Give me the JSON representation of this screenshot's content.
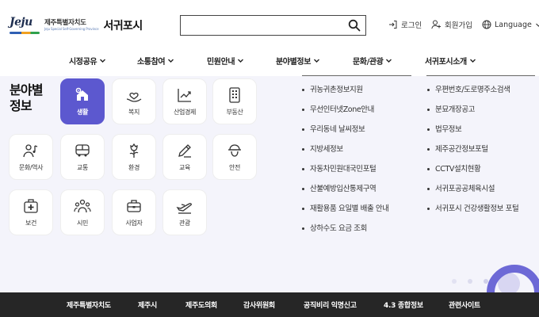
{
  "header": {
    "logo": {
      "mark_text": "Jeju",
      "province": "제주특별자치도",
      "province_en": "Jeju Special Self-Governing Province",
      "city": "서귀포시"
    },
    "search": {
      "value": "",
      "placeholder": ""
    },
    "login_label": "로그인",
    "join_label": "회원가입",
    "language_label": "Language"
  },
  "gnb": [
    {
      "label": "시정공유"
    },
    {
      "label": "소통참여"
    },
    {
      "label": "민원안내"
    },
    {
      "label": "분야별정보"
    },
    {
      "label": "문화/관광"
    },
    {
      "label": "서귀포시소개"
    }
  ],
  "section": {
    "title_line1": "분야별",
    "title_line2": "정보"
  },
  "categories": [
    {
      "label": "생활",
      "icon": "home-gear-icon",
      "active": true
    },
    {
      "label": "복지",
      "icon": "heart-hand-icon",
      "active": false
    },
    {
      "label": "산업경제",
      "icon": "trend-chart-icon",
      "active": false
    },
    {
      "label": "부동산",
      "icon": "building-icon",
      "active": false
    },
    {
      "label": "문화/역사",
      "icon": "person-music-icon",
      "active": false
    },
    {
      "label": "교통",
      "icon": "bus-icon",
      "active": false
    },
    {
      "label": "환경",
      "icon": "flower-icon",
      "active": false
    },
    {
      "label": "교육",
      "icon": "pencil-icon",
      "active": false
    },
    {
      "label": "안전",
      "icon": "helmet-icon",
      "active": false
    },
    {
      "label": "보건",
      "icon": "medical-kit-icon",
      "active": false
    },
    {
      "label": "시민",
      "icon": "people-icon",
      "active": false
    },
    {
      "label": "사업자",
      "icon": "briefcase-icon",
      "active": false
    },
    {
      "label": "관광",
      "icon": "airplane-icon",
      "active": false
    }
  ],
  "links_left": [
    "귀농귀촌정보지원",
    "무선인터넷Zone안내",
    "우리동네 날씨정보",
    "지방세정보",
    "자동차민원대국민포털",
    "산불예방입산통제구역",
    "재활용품 요일별 배출 안내",
    "상하수도 요금 조회"
  ],
  "links_right": [
    "우편번호/도로명주소검색",
    "분묘개장공고",
    "법무정보",
    "제주공간정보포털",
    "CCTV설치현황",
    "서귀포공공체육시설",
    "서귀포시 건강생활정보 포털"
  ],
  "footer": [
    "제주특별자치도",
    "제주시",
    "제주도의회",
    "감사위원회",
    "공직비리 익명신고",
    "4.3 종합정보",
    "관련사이트"
  ],
  "colors": {
    "accent": "#5c58cf",
    "panel_bg": "#f4f4fb",
    "footer_bg": "#262626"
  }
}
